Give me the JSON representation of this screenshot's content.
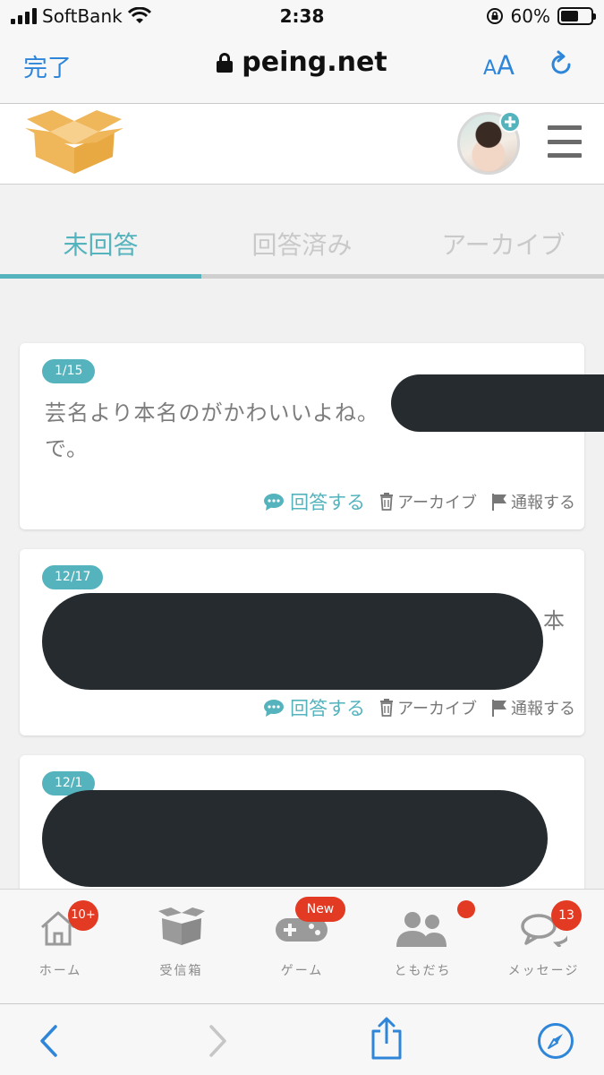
{
  "status_bar": {
    "carrier": "SoftBank",
    "time": "2:38",
    "battery": "60%",
    "battery_level": 0.6
  },
  "browser": {
    "done_label": "完了",
    "url": "peing.net",
    "text_size_label_small": "A",
    "text_size_label_large": "A"
  },
  "tabs": {
    "unanswered": "未回答",
    "answered": "回答済み",
    "archive": "アーカイブ"
  },
  "cards": [
    {
      "date": "1/15",
      "line1": "芸名より本名のがかわいいよね。",
      "line2": "で。",
      "answer": "回答する",
      "archive": "アーカイブ",
      "report": "通報する"
    },
    {
      "date": "12/17",
      "fragment": "本",
      "answer": "回答する",
      "archive": "アーカイブ",
      "report": "通報する"
    },
    {
      "date": "12/1"
    }
  ],
  "bottom_nav": {
    "home": {
      "label": "ホーム",
      "badge": "10+"
    },
    "inbox": {
      "label": "受信箱"
    },
    "game": {
      "label": "ゲーム",
      "badge": "New"
    },
    "friends": {
      "label": "ともだち"
    },
    "messages": {
      "label": "メッセージ",
      "badge": "13"
    }
  },
  "colors": {
    "accent": "#54b3bd",
    "ios_blue": "#2f86d9",
    "badge_red": "#e23a23",
    "logo_orange": "#efb65a",
    "redaction": "#262b2f"
  }
}
